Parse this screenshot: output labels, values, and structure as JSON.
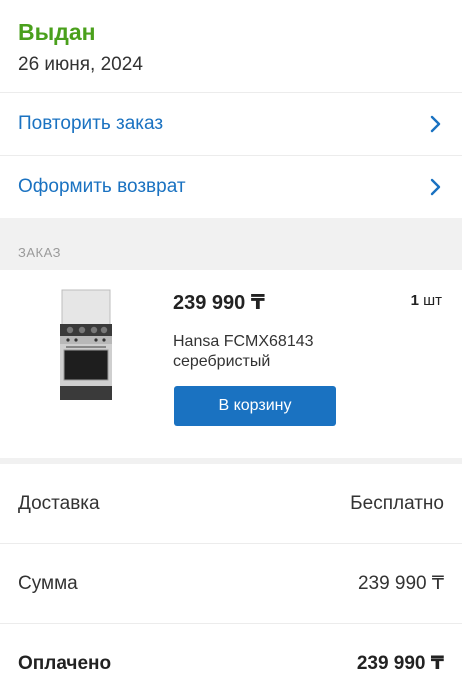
{
  "status": {
    "title": "Выдан",
    "date": "26 июня, 2024"
  },
  "actions": [
    {
      "label": "Повторить заказ"
    },
    {
      "label": "Оформить возврат"
    }
  ],
  "order_section": {
    "label": "ЗАКАЗ"
  },
  "item": {
    "price": "239 990 ₸",
    "qty_number": "1",
    "qty_unit": "шт",
    "name_line1": "Hansa FCMX68143",
    "name_line2": "серебристый",
    "cart_button_label": "В корзину"
  },
  "summary": {
    "delivery_label": "Доставка",
    "delivery_value": "Бесплатно",
    "sum_label": "Сумма",
    "sum_value": "239 990 ₸",
    "paid_label": "Оплачено",
    "paid_value": "239 990 ₸"
  },
  "colors": {
    "status_green": "#4aa01c",
    "link_blue": "#1a72c1",
    "band_gray": "#f1f1f1"
  }
}
